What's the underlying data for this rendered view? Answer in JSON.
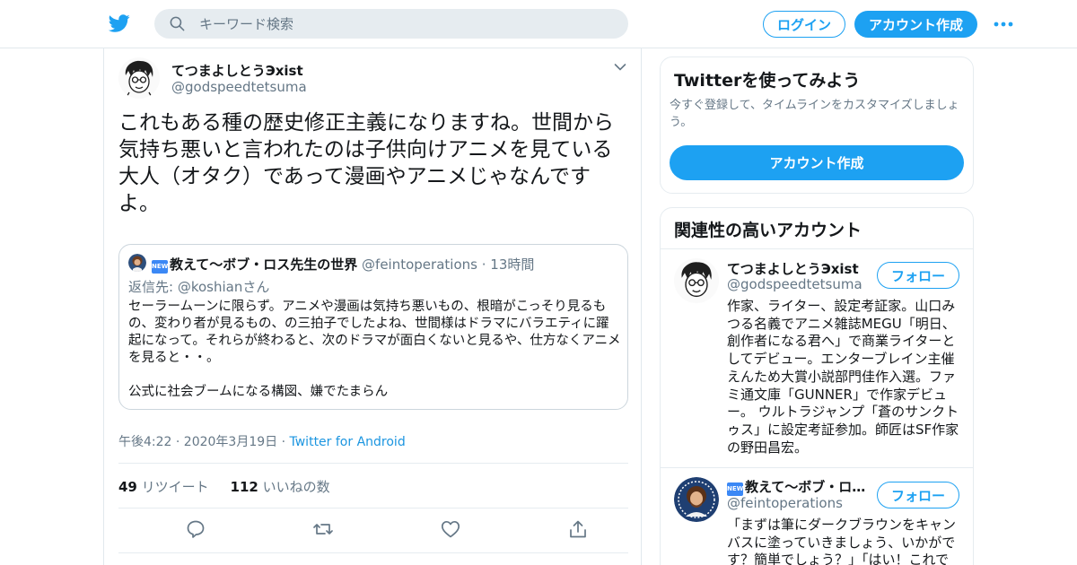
{
  "header": {
    "search_placeholder": "キーワード検索",
    "login_label": "ログイン",
    "signup_label": "アカウント作成",
    "icons": {
      "logo": "twitter-bird-icon",
      "search": "search-icon",
      "more": "more-dots-icon"
    },
    "brand_color": "#1da1f2"
  },
  "tweet": {
    "author_name": "てつまよしとうЭxist",
    "author_handle": "@godspeedtetsuma",
    "text": "これもある種の歴史修正主義になりますね。世間から気持ち悪いと言われたのは子供向けアニメを見ている大人（オタク）であって漫画やアニメじゃなんですよ。",
    "quote": {
      "badge": "NEW",
      "author_name": "教えて〜ボブ・ロス先生の世界",
      "author_handle": "@feintoperations",
      "separator": "·",
      "time": "13時間",
      "reply_prefix": "返信先: ",
      "reply_handle": "@koshian",
      "reply_suffix": "さん",
      "paragraph1": "セーラームーンに限らず。アニメや漫画は気持ち悪いもの、根暗がこっそり見るもの、変わり者が見るもの、の三拍子でしたよね、世間様はドラマにバラエティに躍起になって。それらが終わると、次のドラマが面白くないと見るや、仕方なくアニメを見ると・・。",
      "paragraph2": "公式に社会ブームになる構図、嫌でたまらん"
    },
    "timestamp": "午後4:22 · 2020年3月19日 · ",
    "source": "Twitter for Android",
    "retweet_count": "49",
    "retweet_label": "リツイート",
    "like_count": "112",
    "like_label": "いいねの数",
    "action_icons": [
      "reply-icon",
      "retweet-icon",
      "like-icon",
      "share-icon"
    ]
  },
  "sidebar": {
    "signup_card": {
      "title": "Twitterを使ってみよう",
      "subtitle": "今すぐ登録して、タイムラインをカスタマイズしましょう。",
      "button_label": "アカウント作成"
    },
    "related": {
      "title": "関連性の高いアカウント",
      "accounts": [
        {
          "name": "てつまよしとうЭxist",
          "handle": "@godspeedtetsuma",
          "follow_label": "フォロー",
          "bio": "作家、ライター、設定考証家。山口みつる名義でアニメ雑誌MEGU「明日、創作者になる君へ」で商業ライターとしてデビュー。エンターブレイン主催えんため大賞小説部門佳作入選。ファミ通文庫「GUNNER」で作家デビュー。 ウルトラジャンプ「蒼のサンクトゥス」に設定考証参加。師匠はSF作家の野田昌宏。"
        },
        {
          "badge": "NEW",
          "name": "教えて〜ボブ・ロス先生の世界",
          "handle": "@feintoperations",
          "follow_label": "フォロー",
          "bio": "「まずは筆にダークブラウンをキャンバスに塗っていきましょう、いかがです？簡単でしょう？」「はい！これで"
        }
      ]
    }
  }
}
